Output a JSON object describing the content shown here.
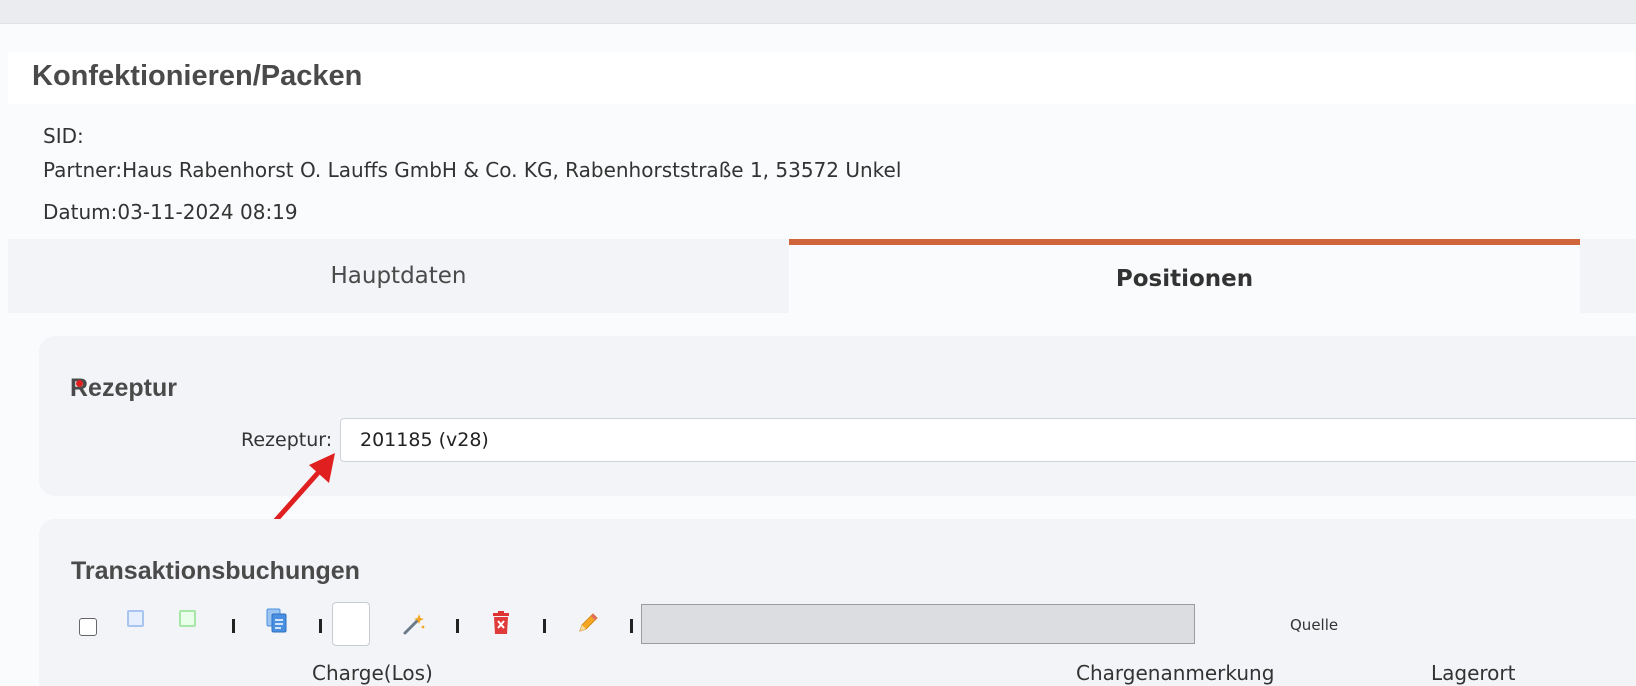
{
  "header": {
    "title": "Konfektionieren/Packen",
    "sid_label": "SID:",
    "sid_value": "",
    "partner_label": "Partner:",
    "partner_value": "Haus Rabenhorst O. Lauffs GmbH & Co. KG, Rabenhorststraße 1, 53572 Unkel",
    "datum_label": "Datum:",
    "datum_value": "03-11-2024 08:19"
  },
  "tabs": [
    {
      "label": "Hauptdaten",
      "active": false
    },
    {
      "label": "Positionen",
      "active": true
    }
  ],
  "rezeptur_section": {
    "title": "Rezeptur",
    "field_label": "Rezeptur:",
    "field_value": "201185 (v28)"
  },
  "transactions_section": {
    "title": "Transaktionsbuchungen",
    "quelle_label": "Quelle",
    "search_value": "",
    "columns": [
      "Charge(Los)",
      "Chargenanmerkung",
      "Lagerort"
    ]
  },
  "toolbar_icons": [
    "checkbox-icon",
    "blue-square-icon",
    "green-square-icon",
    "copy-document-icon",
    "magic-wand-icon",
    "delete-icon",
    "pencil-icon"
  ],
  "colors": {
    "accent": "#d0643a",
    "annotation_arrow": "#e02020",
    "panel_bg": "#f3f4f7"
  }
}
